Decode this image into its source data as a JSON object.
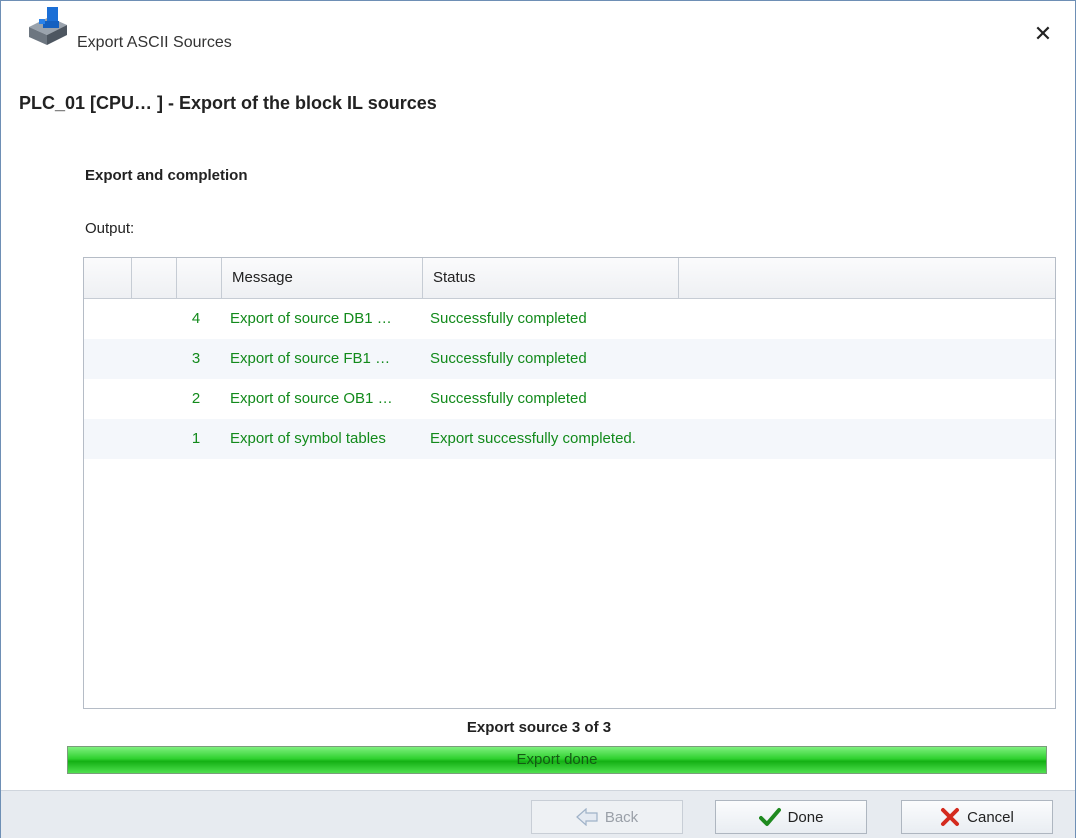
{
  "window": {
    "title": "Export ASCII Sources",
    "app_icon": "step7-cube-icon",
    "close_glyph": "✕"
  },
  "header": {
    "title": "PLC_01 [CPU… ]  - Export of the block IL sources"
  },
  "section": {
    "title": "Export and completion",
    "output_label": "Output:"
  },
  "table": {
    "columns": [
      "",
      "",
      "",
      "Message",
      "Status",
      ""
    ],
    "rows": [
      {
        "num": "4",
        "message": "Export of source DB1 …",
        "status": "Successfully completed"
      },
      {
        "num": "3",
        "message": "Export of source FB1 …",
        "status": "Successfully completed"
      },
      {
        "num": "2",
        "message": "Export of source OB1 …",
        "status": "Successfully completed"
      },
      {
        "num": "1",
        "message": "Export of symbol tables",
        "status": "Export successfully completed."
      }
    ],
    "row_text_color": "#128a1b"
  },
  "progress": {
    "caption": "Export source 3 of 3",
    "label": "Export done",
    "value_percent": 100,
    "color": "#22c322"
  },
  "footer": {
    "back_label": "Back",
    "done_label": "Done",
    "cancel_label": "Cancel"
  }
}
